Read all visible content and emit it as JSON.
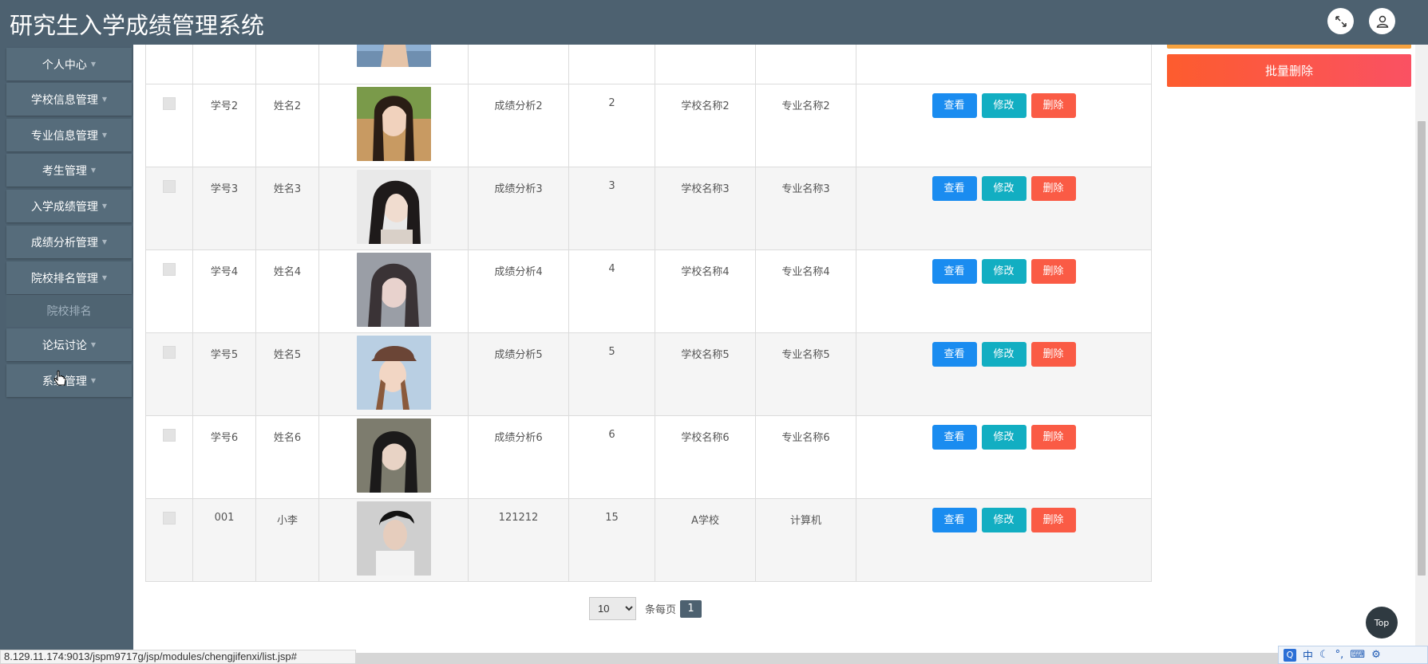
{
  "app": {
    "title": "研究生入学成绩管理系统"
  },
  "header": {
    "fullscreen_icon": "expand-icon",
    "user_icon": "user-icon"
  },
  "sidebar": {
    "items": [
      {
        "label": "个人中心"
      },
      {
        "label": "学校信息管理"
      },
      {
        "label": "专业信息管理"
      },
      {
        "label": "考生管理"
      },
      {
        "label": "入学成绩管理"
      },
      {
        "label": "成绩分析管理"
      },
      {
        "label": "院校排名管理"
      },
      {
        "label": "论坛讨论"
      },
      {
        "label": "系统管理"
      }
    ],
    "submenu": {
      "label": "院校排名"
    }
  },
  "toolbar": {
    "batch_delete_label": "批量删除"
  },
  "actions": {
    "view_label": "查看",
    "edit_label": "修改",
    "delete_label": "删除"
  },
  "table": {
    "rows": [
      {
        "id": "学号2",
        "name": "姓名2",
        "analysis": "成绩分析2",
        "rank": "2",
        "school": "学校名称2",
        "major": "专业名称2"
      },
      {
        "id": "学号3",
        "name": "姓名3",
        "analysis": "成绩分析3",
        "rank": "3",
        "school": "学校名称3",
        "major": "专业名称3"
      },
      {
        "id": "学号4",
        "name": "姓名4",
        "analysis": "成绩分析4",
        "rank": "4",
        "school": "学校名称4",
        "major": "专业名称4"
      },
      {
        "id": "学号5",
        "name": "姓名5",
        "analysis": "成绩分析5",
        "rank": "5",
        "school": "学校名称5",
        "major": "专业名称5"
      },
      {
        "id": "学号6",
        "name": "姓名6",
        "analysis": "成绩分析6",
        "rank": "6",
        "school": "学校名称6",
        "major": "专业名称6"
      },
      {
        "id": "001",
        "name": "小李",
        "analysis": "121212",
        "rank": "15",
        "school": "A学校",
        "major": "计算机"
      }
    ]
  },
  "pagination": {
    "page_size": "10",
    "per_page_label": "条每页",
    "current_page": "1"
  },
  "top_button": {
    "label": "Top"
  },
  "status": {
    "url": "8.129.11.174:9013/jspm9717g/jsp/modules/chengjifenxi/list.jsp#"
  },
  "ime": {
    "mode_label": "中",
    "logo_label": "Q"
  },
  "colors": {
    "header_bg": "#4d6170",
    "view_btn": "#1a8cf0",
    "edit_btn": "#12aec2",
    "delete_btn": "#fa5b45",
    "batch_delete": "#fd5c2e"
  }
}
